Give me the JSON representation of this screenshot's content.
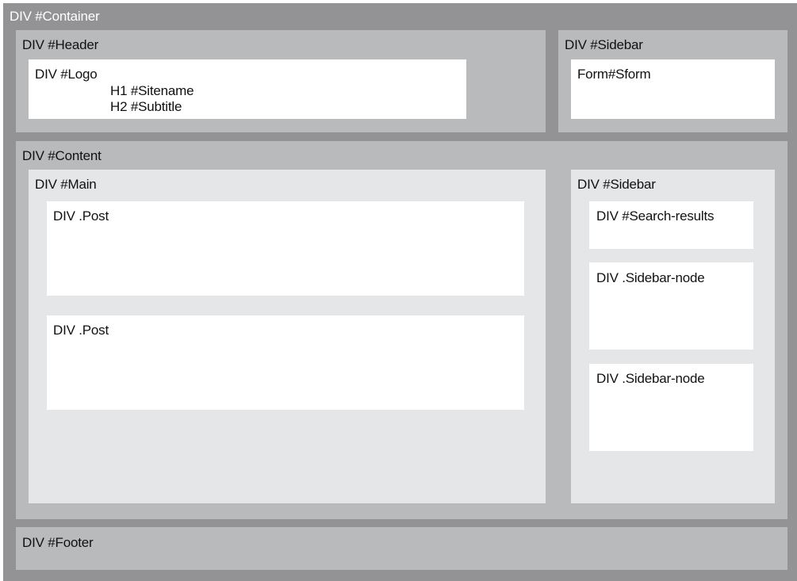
{
  "container": {
    "label": "DIV #Container"
  },
  "header": {
    "label": "DIV #Header",
    "logo": {
      "label": "DIV #Logo",
      "sitename": "H1 #Sitename",
      "subtitle": "H2 #Subtitle"
    }
  },
  "top_sidebar": {
    "label": "DIV #Sidebar",
    "form": "Form#Sform"
  },
  "content": {
    "label": "DIV #Content",
    "main": {
      "label": "DIV #Main",
      "posts": [
        "DIV .Post",
        "DIV .Post"
      ]
    },
    "sidebar": {
      "label": "DIV #Sidebar",
      "search_results": "DIV #Search-results",
      "nodes": [
        "DIV .Sidebar-node",
        "DIV .Sidebar-node"
      ]
    }
  },
  "footer": {
    "label": "DIV #Footer"
  },
  "colors": {
    "container": "#939395",
    "section": "#b9babc",
    "inner": "#e5e6e7",
    "leaf": "#ffffff"
  }
}
